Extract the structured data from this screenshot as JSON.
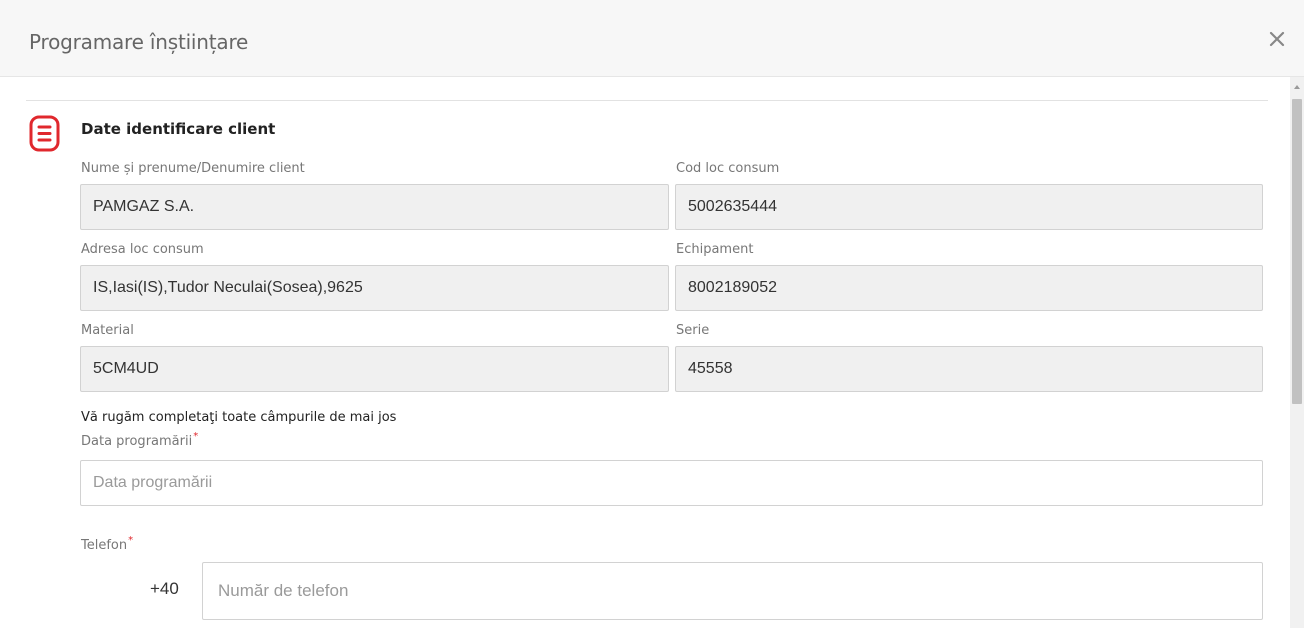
{
  "dialog": {
    "title": "Programare înștiințare",
    "close_icon": "close-icon"
  },
  "section": {
    "icon": "document-list-icon",
    "icon_color": "#e0282d",
    "title": "Date identificare client"
  },
  "fields": {
    "client_name": {
      "label": "Nume și prenume/Denumire client",
      "value": "PAMGAZ S.A."
    },
    "consumption_code": {
      "label": "Cod loc consum",
      "value": "5002635444"
    },
    "consumption_address": {
      "label": "Adresa loc consum",
      "value": "IS,Iasi(IS),Tudor Neculai(Sosea),9625"
    },
    "equipment": {
      "label": "Echipament",
      "value": "8002189052"
    },
    "material": {
      "label": "Material",
      "value": "5CM4UD"
    },
    "serial": {
      "label": "Serie",
      "value": "45558"
    }
  },
  "form": {
    "instruction": "Vă rugăm completaţi toate câmpurile de mai jos",
    "date": {
      "label": "Data programării",
      "required_mark": "*",
      "placeholder": "Data programării",
      "value": ""
    },
    "phone": {
      "label": "Telefon",
      "required_mark": "*",
      "prefix": "+40",
      "placeholder": "Număr de telefon",
      "value": ""
    }
  },
  "colors": {
    "accent": "#e0282d",
    "readonly_bg": "#f0f0f0",
    "header_bg": "#f7f7f7"
  }
}
